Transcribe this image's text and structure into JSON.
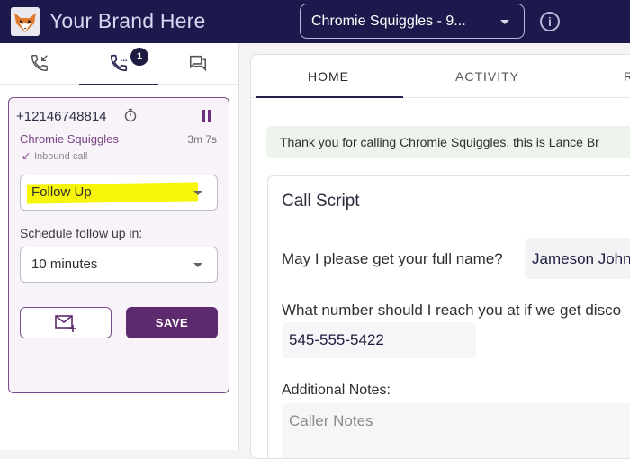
{
  "header": {
    "brand": "Your Brand Here",
    "campaign_select": "Chromie Squiggles - 9...",
    "info_icon": "info-icon"
  },
  "left_tabs": {
    "items": [
      {
        "icon": "call-history-icon"
      },
      {
        "icon": "active-call-icon",
        "badge": "1"
      },
      {
        "icon": "chat-icon"
      }
    ]
  },
  "call": {
    "phone": "+12146748814",
    "caller": "Chromie Squiggles",
    "duration": "3m 7s",
    "direction": "Inbound call",
    "disposition": "Follow Up",
    "schedule_label": "Schedule follow up in:",
    "schedule_value": "10 minutes",
    "save_label": "SAVE"
  },
  "right_tabs": {
    "home": "HOME",
    "activity": "ACTIVITY",
    "more": "R"
  },
  "greeting": "Thank you for calling Chromie Squiggles, this is Lance Br",
  "script": {
    "title": "Call Script",
    "q1": "May I please get your full name?",
    "a1": "Jameson Johns",
    "q2": "What number should I reach you at if we get disco",
    "a2": "545-555-5422",
    "q3": "Additional Notes:",
    "notes_placeholder": "Caller Notes"
  },
  "colors": {
    "header_bg": "#1c1a4d",
    "accent_purple": "#5d2b6d",
    "highlight": "#f6f50a"
  }
}
